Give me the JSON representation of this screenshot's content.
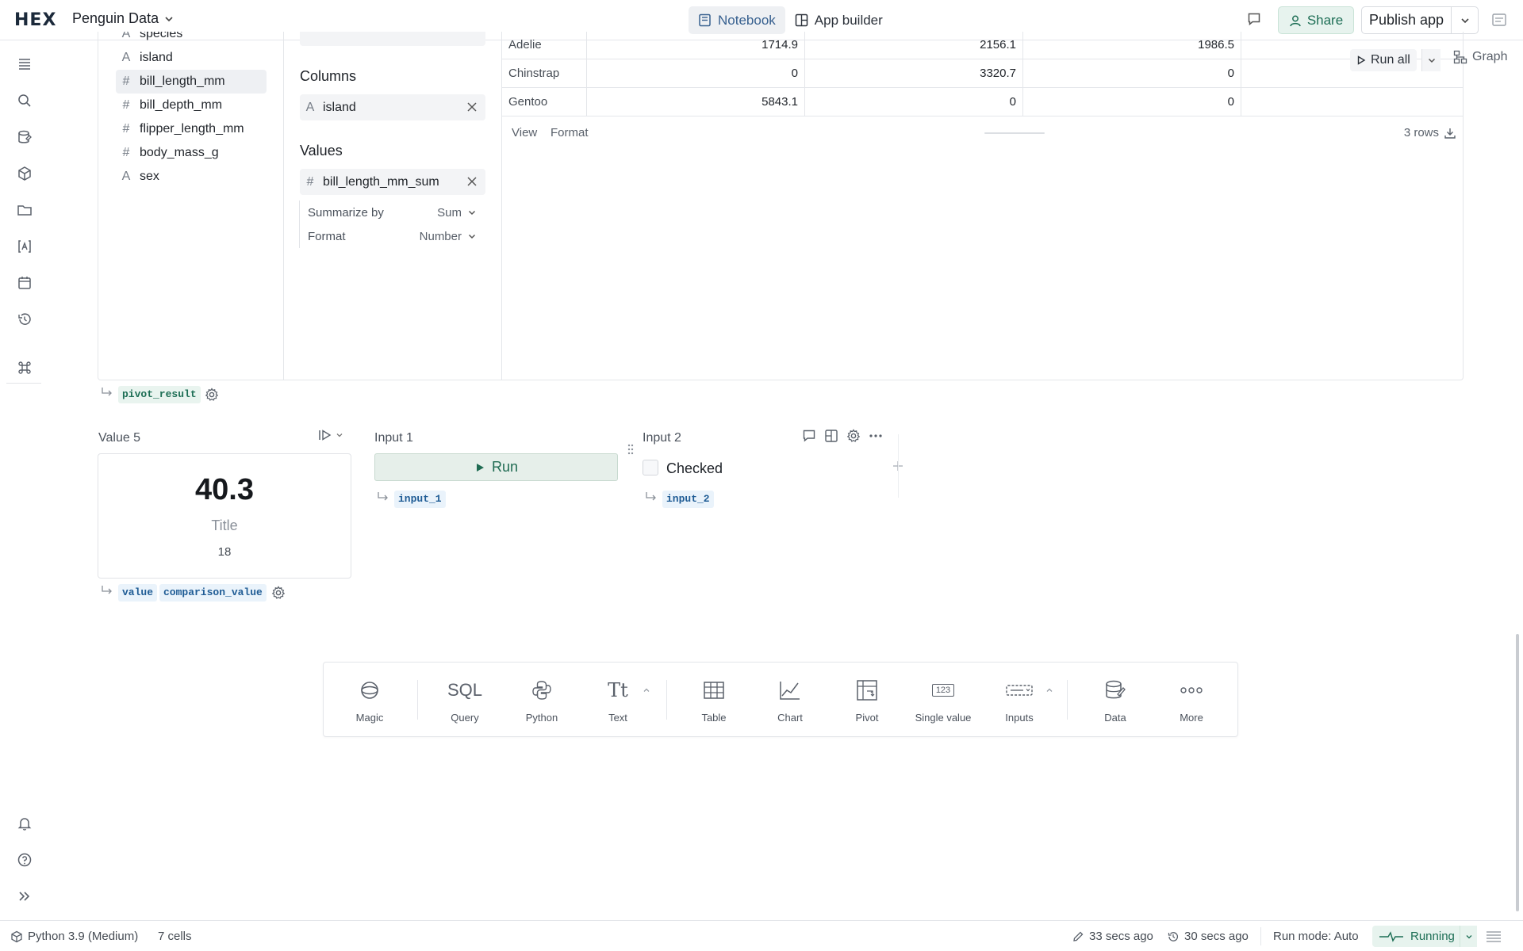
{
  "topbar": {
    "logo": "HEX",
    "project_title": "Penguin Data",
    "mode_notebook": "Notebook",
    "mode_app_builder": "App builder",
    "share_label": "Share",
    "publish_label": "Publish app"
  },
  "pivot": {
    "fields": [
      {
        "type": "text",
        "name": "species"
      },
      {
        "type": "text",
        "name": "island"
      },
      {
        "type": "number",
        "name": "bill_length_mm"
      },
      {
        "type": "number",
        "name": "bill_depth_mm"
      },
      {
        "type": "number",
        "name": "flipper_length_mm"
      },
      {
        "type": "number",
        "name": "body_mass_g"
      },
      {
        "type": "text",
        "name": "sex"
      }
    ],
    "columns_heading": "Columns",
    "column_chip": "island",
    "values_heading": "Values",
    "value_chip": "bill_length_mm_sum",
    "summarize_label": "Summarize by",
    "summarize_value": "Sum",
    "format_label": "Format",
    "format_value": "Number",
    "rows": [
      [
        "Adelie",
        "1714.9",
        "2156.1",
        "1986.5"
      ],
      [
        "Chinstrap",
        "0",
        "3320.7",
        "0"
      ],
      [
        "Gentoo",
        "5843.1",
        "0",
        "0"
      ]
    ],
    "footer_view": "View",
    "footer_format": "Format",
    "row_count": "3 rows",
    "run_all": "Run all",
    "graph": "Graph",
    "output_var": "pivot_result"
  },
  "value_cell": {
    "label": "Value 5",
    "value": "40.3",
    "title": "Title",
    "comparison": "18",
    "vars": [
      "value",
      "comparison_value"
    ]
  },
  "input1": {
    "label": "Input 1",
    "button": "Run",
    "var": "input_1"
  },
  "input2": {
    "label": "Input 2",
    "checkbox_label": "Checked",
    "var": "input_2"
  },
  "add_cell": {
    "items": [
      {
        "label": "Magic",
        "icon": "magic-icon"
      },
      {
        "label": "Query",
        "icon": "sql-icon",
        "glyph": "SQL"
      },
      {
        "label": "Python",
        "icon": "python-icon"
      },
      {
        "label": "Text",
        "icon": "text-icon",
        "glyph": "Tt"
      },
      {
        "label": "Table",
        "icon": "table-icon"
      },
      {
        "label": "Chart",
        "icon": "chart-icon"
      },
      {
        "label": "Pivot",
        "icon": "pivot-icon"
      },
      {
        "label": "Single value",
        "icon": "single-value-icon",
        "glyph": "123"
      },
      {
        "label": "Inputs",
        "icon": "inputs-icon"
      },
      {
        "label": "Data",
        "icon": "data-icon"
      },
      {
        "label": "More",
        "icon": "more-icon"
      }
    ]
  },
  "status": {
    "kernel": "Python 3.9 (Medium)",
    "cells": "7 cells",
    "edited": "33 secs ago",
    "ran": "30 secs ago",
    "run_mode": "Run mode: Auto",
    "running": "Running"
  },
  "colors": {
    "accent_green": "#1d6e55",
    "accent_blue": "#37608f",
    "border": "#e4e6ea"
  }
}
